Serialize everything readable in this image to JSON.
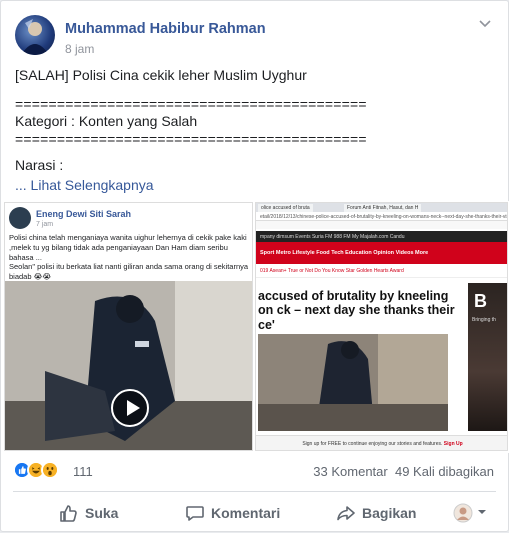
{
  "post": {
    "author": "Muhammad Habibur Rahman",
    "time": "8 jam",
    "lines": [
      "[SALAH] Polisi Cina cekik leher Muslim Uyghur",
      "==========================================",
      "Kategori : Konten yang Salah",
      "==========================================",
      "Narasi :"
    ],
    "see_more": "... Lihat Selengkapnya"
  },
  "left_screenshot": {
    "author": "Eneng Dewi Siti Sarah",
    "time": "7 jam",
    "text_1": "Polisi china telah menganiaya wanita uighur lehernya di cekik pake kaki ,melek tu yg bilang tidak ada penganiayaan Dan Ham diam seribu bahasa ...",
    "text_2": "Seolan\" polisi itu berkata liat nanti giliran anda sama orang di sekitarnya biadab 😭😭"
  },
  "right_screenshot": {
    "tab_1": "olice accused of bruta",
    "tab_2": "Forum Anti Fitnah, Hasut, dan H",
    "url": "etail/2018/12/13/chinese-police-accused-of-brutality-by-kneeling-on-womans-neck--next-day-she-thanks-their-viscerot",
    "nav_1": "mpany   dimsum   Events   Suria FM   988 FM   My Majalah.com   Candu",
    "nav_2": "Sport   Metro   Lifestyle   Food   Tech   Education   Opinion   Videos   More",
    "nav_3": "019      Asean+      True or Not      Do You Know      Star Golden Hearts Award",
    "headline": "accused of brutality by kneeling on ck – next day she thanks their ce'",
    "ad_big": "B",
    "ad_small": "Bringing th",
    "signup_text": "Sign up for FREE to continue enjoying our stories and features.",
    "signup_link": "Sign Up"
  },
  "stats": {
    "reaction_count": "111",
    "comments": "33 Komentar",
    "shares": "49 Kali dibagikan"
  },
  "actions": {
    "like": "Suka",
    "comment": "Komentari",
    "share": "Bagikan"
  },
  "colors": {
    "link": "#385898",
    "brand_red": "#d0021b",
    "like_blue": "#1877f2"
  }
}
